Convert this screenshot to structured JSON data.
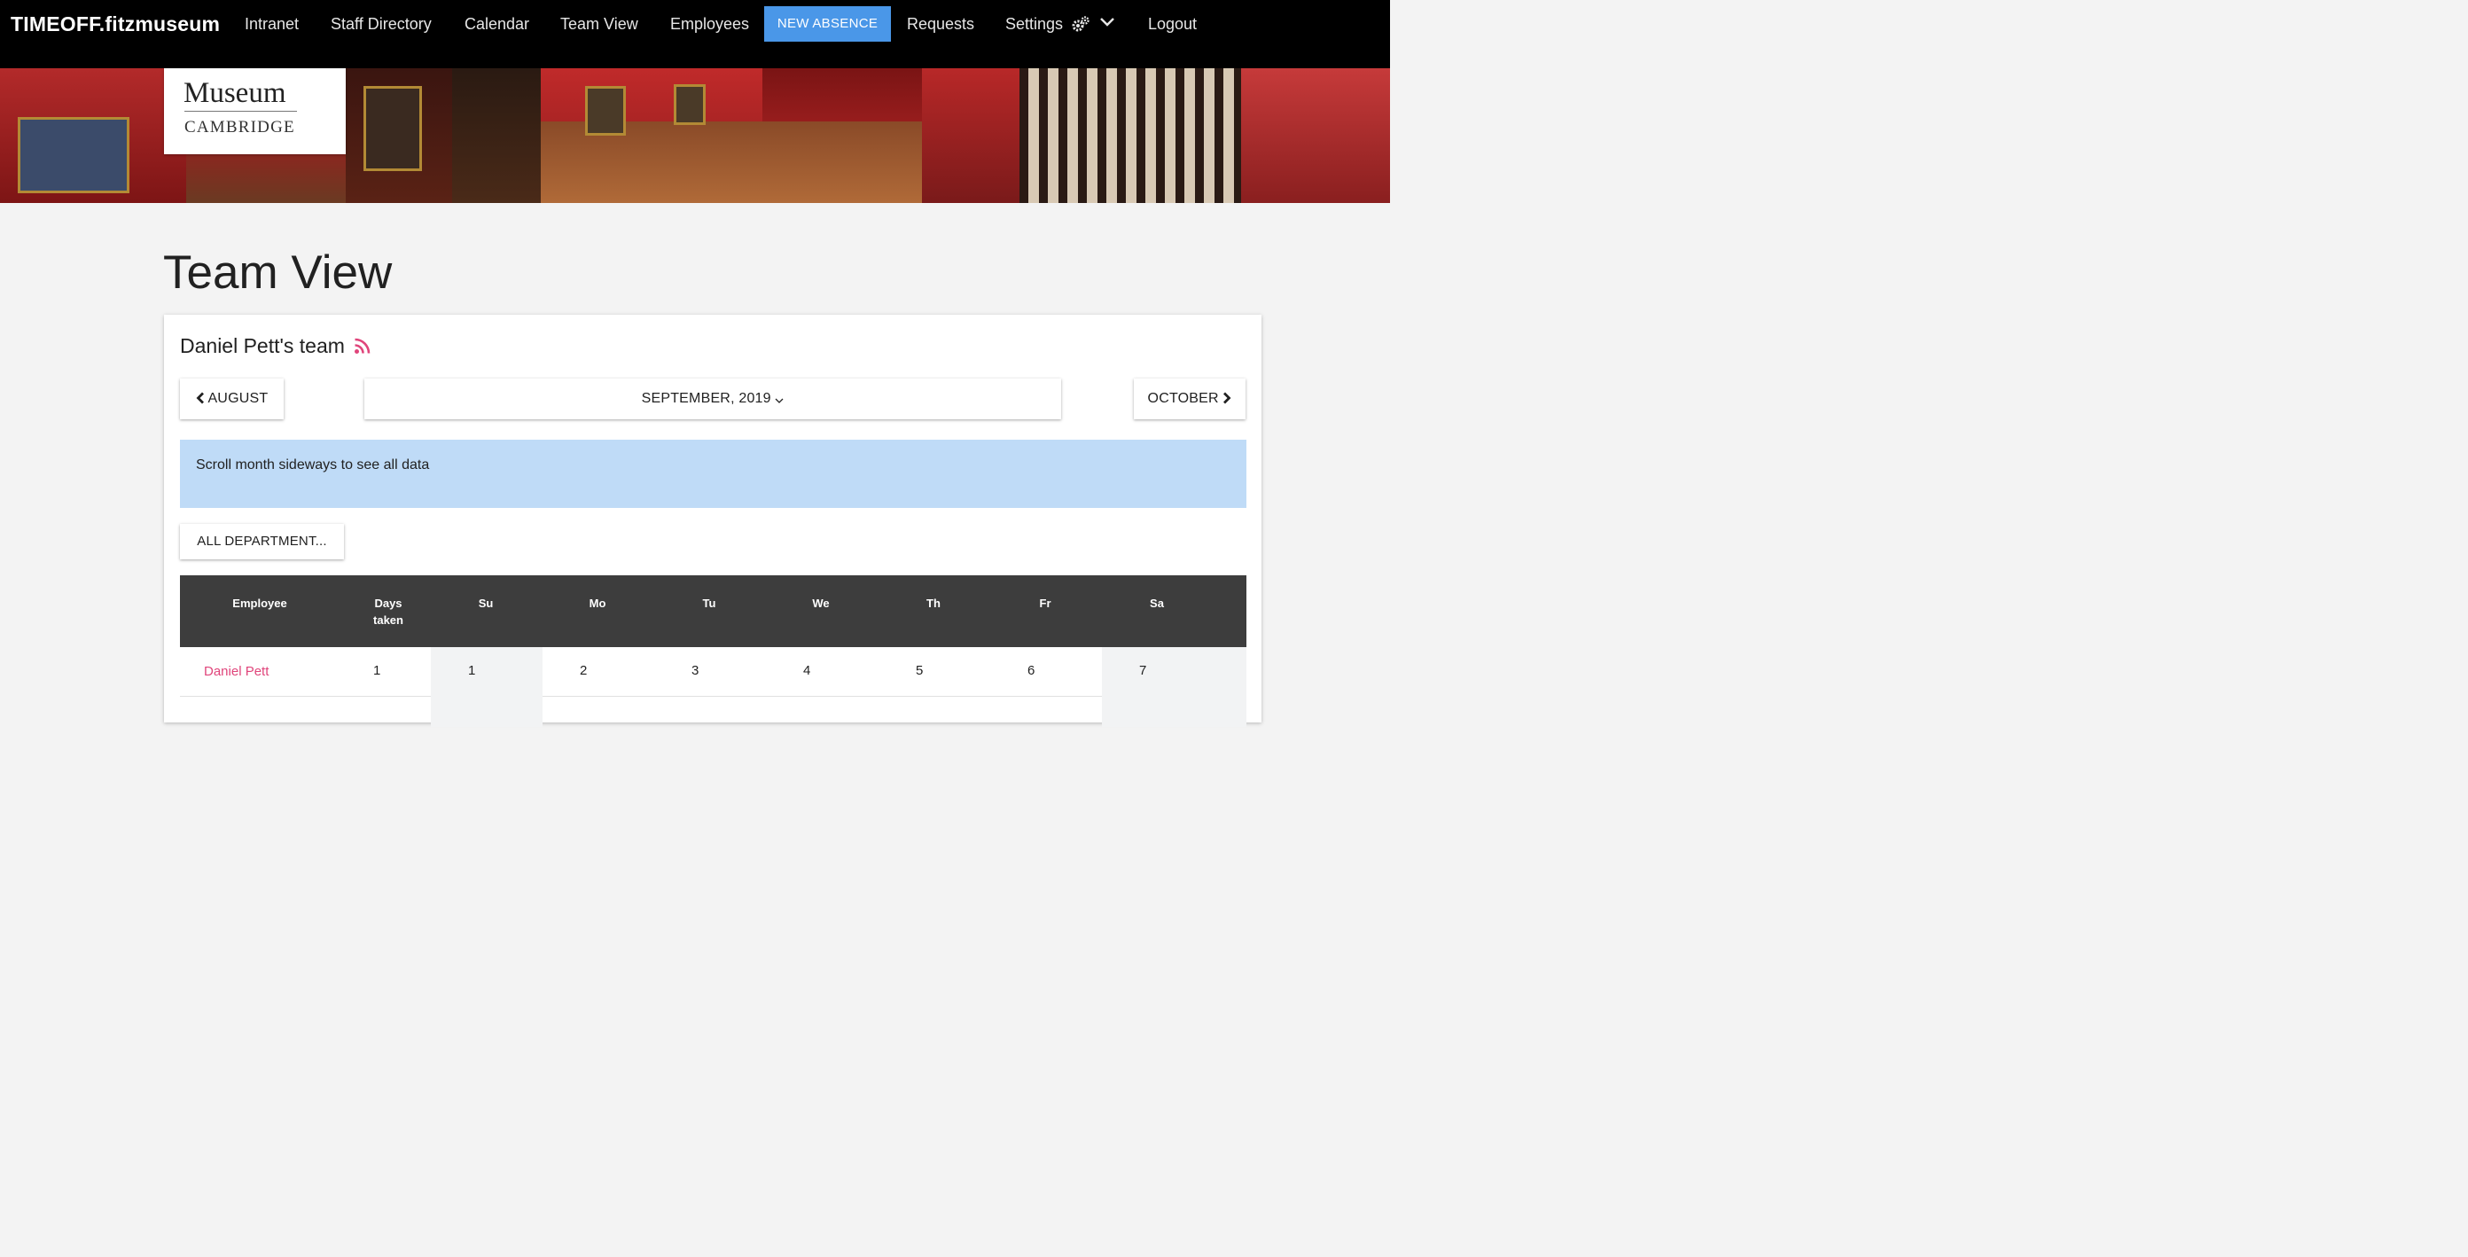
{
  "navbar": {
    "brand_main": "TIMEOFF",
    "brand_suffix": ".fitzmuseum",
    "items": [
      "Intranet",
      "Staff Directory",
      "Calendar",
      "Team View",
      "Employees"
    ],
    "cta": "NEW ABSENCE",
    "requests": "Requests",
    "settings": "Settings",
    "logout": "Logout"
  },
  "banner": {
    "logo_title": "Museum",
    "logo_sub": "CAMBRIDGE"
  },
  "page": {
    "title": "Team View"
  },
  "team": {
    "title": "Daniel Pett's team",
    "prev_month": "AUGUST",
    "current_month": "SEPTEMBER, 2019",
    "next_month": "OCTOBER",
    "info": "Scroll month sideways to see all data",
    "department_filter": "ALL DEPARTMENT..."
  },
  "table": {
    "headers": {
      "employee": "Employee",
      "days_taken_1": "Days",
      "days_taken_2": "taken",
      "days": [
        "Su",
        "Mo",
        "Tu",
        "We",
        "Th",
        "Fr",
        "Sa"
      ]
    },
    "rows": [
      {
        "employee": "Daniel Pett",
        "days_taken": "1",
        "dates": [
          "1",
          "2",
          "3",
          "4",
          "5",
          "6",
          "7"
        ]
      }
    ]
  },
  "colors": {
    "navbar_bg": "#000000",
    "cta_bg": "#4a97e8",
    "info_bg": "#bfdbf7",
    "table_header_bg": "#3d3d3d",
    "link": "#e0457b"
  }
}
